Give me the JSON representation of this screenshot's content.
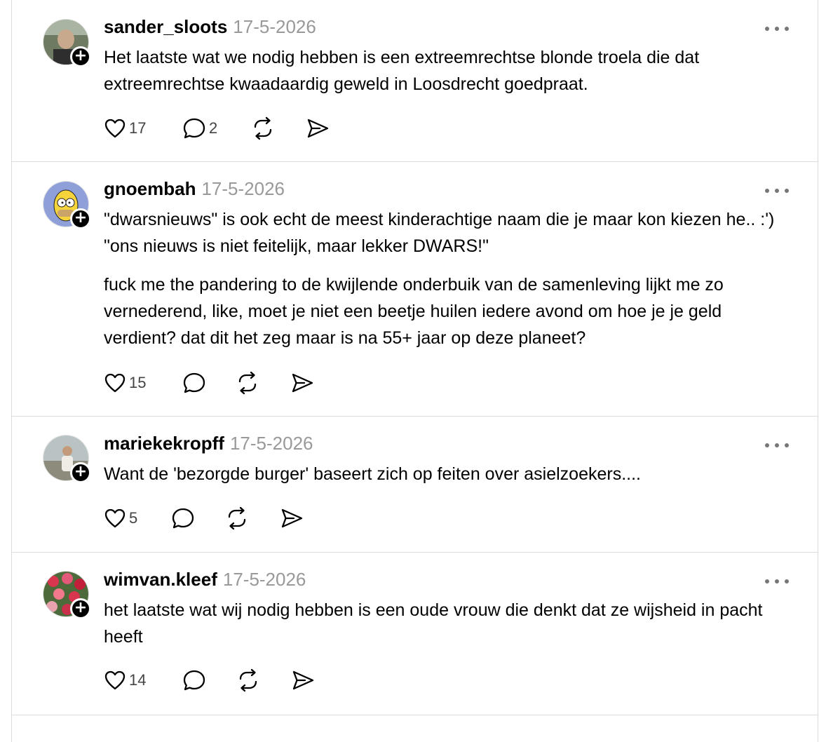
{
  "posts": [
    {
      "username": "sander_sloots",
      "timestamp": "17-5-2026",
      "paragraphs": [
        "Het laatste wat we nodig hebben is een extreemrechtse blonde troela die dat extreemrechtse kwaadaardig geweld in Loosdrecht goedpraat."
      ],
      "likes": "17",
      "replies": "2",
      "avatar": "man-outdoors"
    },
    {
      "username": "gnoembah",
      "timestamp": "17-5-2026",
      "paragraphs": [
        "\"dwarsnieuws\" is ook echt de meest kinderachtige naam die je maar kon kiezen he.. :') \"ons nieuws is niet feitelijk, maar lekker DWARS!\"",
        "fuck me the pandering to de kwijlende onderbuik van de samenleving lijkt me zo vernederend, like, moet je niet een beetje huilen iedere avond om hoe je je geld verdient? dat dit het zeg maar is na 55+ jaar op deze planeet?"
      ],
      "likes": "15",
      "replies": "",
      "avatar": "cartoon-character"
    },
    {
      "username": "mariekekropff",
      "timestamp": "17-5-2026",
      "paragraphs": [
        "Want de 'bezorgde burger' baseert zich op feiten over asielzoekers...."
      ],
      "likes": "5",
      "replies": "",
      "avatar": "person-by-water"
    },
    {
      "username": "wimvan.kleef",
      "timestamp": "17-5-2026",
      "paragraphs": [
        "het laatste wat wij nodig hebben is een oude vrouw die denkt dat ze wijsheid in pacht heeft"
      ],
      "likes": "14",
      "replies": "",
      "avatar": "tulips"
    }
  ],
  "icons": {
    "like": "heart-icon",
    "reply": "comment-icon",
    "repost": "repost-icon",
    "share": "send-icon",
    "more": "more-icon",
    "follow": "plus-icon"
  },
  "follow_symbol": "+"
}
